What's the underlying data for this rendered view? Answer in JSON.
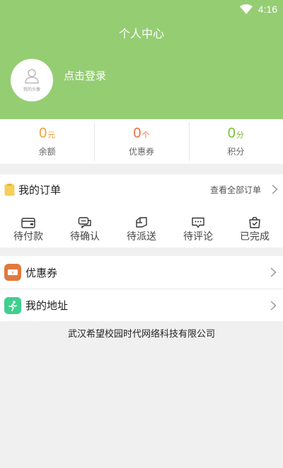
{
  "status_bar": {
    "time": "4:16"
  },
  "header": {
    "title": "个人中心",
    "avatar_caption": "我的头像",
    "login_text": "点击登录",
    "bg_color": "#95cd73"
  },
  "stats": [
    {
      "value": "0",
      "unit": "元",
      "label": "余额",
      "color": "#f0a23b"
    },
    {
      "value": "0",
      "unit": "个",
      "label": "优惠券",
      "color": "#e8734a"
    },
    {
      "value": "0",
      "unit": "分",
      "label": "积分",
      "color": "#7cbf3a"
    }
  ],
  "orders": {
    "title": "我的订单",
    "view_all": "查看全部订单",
    "items": [
      {
        "label": "待付款",
        "icon": "wallet-icon"
      },
      {
        "label": "待确认",
        "icon": "chat-confirm-icon"
      },
      {
        "label": "待派送",
        "icon": "truck-icon"
      },
      {
        "label": "待评论",
        "icon": "comment-icon"
      },
      {
        "label": "已完成",
        "icon": "bag-check-icon"
      }
    ]
  },
  "menu": [
    {
      "label": "优惠券",
      "icon": "coupon-icon",
      "icon_color": "#e07a3f"
    },
    {
      "label": "我的地址",
      "icon": "address-runner-icon",
      "icon_color": "#3fcf8e"
    }
  ],
  "footer": {
    "company": "武汉希望校园时代网络科技有限公司"
  }
}
